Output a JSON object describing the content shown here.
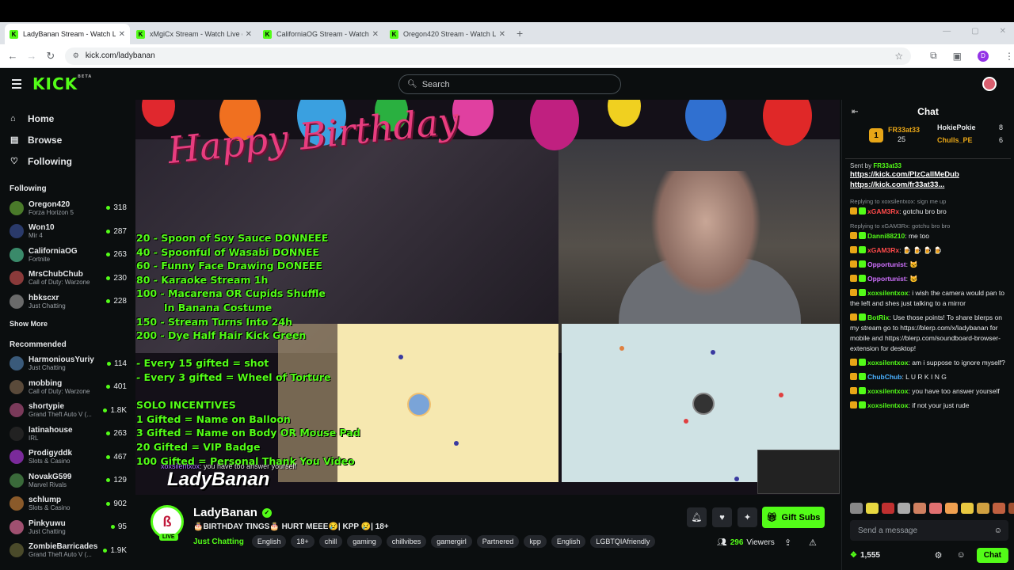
{
  "browser": {
    "tabs": [
      {
        "label": "LadyBanan Stream - Watch Live",
        "active": true
      },
      {
        "label": "xMgiCx Stream - Watch Live on",
        "active": false
      },
      {
        "label": "CaliforniaOG Stream - Watch Li",
        "active": false
      },
      {
        "label": "Oregon420 Stream - Watch Live",
        "active": false
      }
    ],
    "url": "kick.com/ladybanan",
    "profile_initial": "D"
  },
  "header": {
    "logo": "KICK",
    "logo_sup": "BETA",
    "search_placeholder": "Search"
  },
  "sidebar": {
    "nav": [
      {
        "label": "Home",
        "icon": "home-icon"
      },
      {
        "label": "Browse",
        "icon": "browse-icon"
      },
      {
        "label": "Following",
        "icon": "heart-icon"
      }
    ],
    "following_title": "Following",
    "following": [
      {
        "name": "Oregon420",
        "category": "Forza Horizon 5",
        "viewers": "318",
        "color": "#4a7a2a"
      },
      {
        "name": "Won10",
        "category": "Mir 4",
        "viewers": "287",
        "color": "#2a3a6a"
      },
      {
        "name": "CaliforniaOG",
        "category": "Fortnite",
        "viewers": "263",
        "color": "#3a8a6a"
      },
      {
        "name": "MrsChubChub",
        "category": "Call of Duty: Warzone",
        "viewers": "230",
        "color": "#8a3a3a"
      },
      {
        "name": "hbkscxr",
        "category": "Just Chatting",
        "viewers": "228",
        "color": "#6a6a6a"
      }
    ],
    "show_more": "Show More",
    "recommended_title": "Recommended",
    "recommended": [
      {
        "name": "HarmoniousYuriy",
        "category": "Just Chatting",
        "viewers": "114",
        "color": "#3a5a7a"
      },
      {
        "name": "mobbing",
        "category": "Call of Duty: Warzone",
        "viewers": "401",
        "color": "#5a4a3a"
      },
      {
        "name": "shortypie",
        "category": "Grand Theft Auto V (...",
        "viewers": "1.8K",
        "color": "#7a3a5a"
      },
      {
        "name": "latinahouse",
        "category": "IRL",
        "viewers": "263",
        "color": "#222222"
      },
      {
        "name": "Prodigyddk",
        "category": "Slots & Casino",
        "viewers": "467",
        "color": "#7a2a9a"
      },
      {
        "name": "NovakG599",
        "category": "Marvel Rivals",
        "viewers": "129",
        "color": "#3a6a3a"
      },
      {
        "name": "schlump",
        "category": "Slots & Casino",
        "viewers": "902",
        "color": "#8a5a2a"
      },
      {
        "name": "Pinkyuwu",
        "category": "Just Chatting",
        "viewers": "95",
        "color": "#a05070"
      },
      {
        "name": "ZombieBarricades",
        "category": "Grand Theft Auto V (...",
        "viewers": "1.9K",
        "color": "#4a4a2a"
      }
    ]
  },
  "video": {
    "banner": "Happy Birthday",
    "overlay_lines": "20 - Spoon of Soy Sauce DONNEEE\n40 - Spoonful of Wasabi DONNEE\n60 - Funny Face Drawing DONEEE\n80 - Karaoke Stream 1h\n100 - Macarena OR Cupids Shuffle\n        In Banana Costume\n150 - Stream Turns Into 24h\n200 - Dye Half Hair Kick Green\n\n- Every 15 gifted = shot\n- Every 3 gifted = Wheel of Torture\n\nSOLO INCENTIVES\n1 Gifted = Name on Balloon\n3 Gifted = Name on Body OR Mouse Pad\n20 Gifted = VIP Badge\n100 Gifted = Personal Thank You Video",
    "watermark": "LadyBanan",
    "ghost_user": "xoxsilentxox",
    "ghost_msg": ": you have too answer yourself"
  },
  "stream": {
    "name": "LadyBanan",
    "live": "LIVE",
    "title": "🎂BIRTHDAY TINGS🎂 HURT MEEE😢| KPP 😢| 18+",
    "category": "Just Chatting",
    "tags": [
      "English",
      "18+",
      "chill",
      "gaming",
      "chillvibes",
      "gamergirl",
      "Partnered",
      "kpp",
      "English",
      "LGBTQIAfriendly"
    ],
    "gift_label": "Gift Subs",
    "viewers": "296",
    "viewers_label": "Viewers"
  },
  "chat": {
    "title": "Chat",
    "leaderboard": [
      {
        "rank": "1",
        "name": "FR33at33",
        "value": "25",
        "color": "#e8a617"
      },
      {
        "name": "HokiePokie",
        "value": "8",
        "color": "#e6e8ea"
      },
      {
        "name": "Chulls_PE",
        "value": "6",
        "color": "#e8a617"
      }
    ],
    "pinned_by_label": "Sent by",
    "pinned_by": "FR33at33",
    "pinned_links": [
      "https://kick.com/PlzCallMeDub",
      "https://kick.com/fr33at33..."
    ],
    "messages": [
      {
        "reply": "Replying to xoxsilentxox: sign me up",
        "user": "xGAM3Rx",
        "ucolor": "#ff4a4a",
        "text": ": gotchu bro bro"
      },
      {
        "reply": "Replying to xGAM3Rx: gotchu bro bro",
        "user": "Danni88210",
        "ucolor": "#53fc18",
        "text": ": me too"
      },
      {
        "reply": "",
        "user": "xGAM3Rx",
        "ucolor": "#ff4a4a",
        "text": ": 🍺 🍺 🍺 🍺"
      },
      {
        "reply": "",
        "user": "Opportunist",
        "ucolor": "#d070ff",
        "text": ": 🐱"
      },
      {
        "reply": "",
        "user": "Opportunist",
        "ucolor": "#d070ff",
        "text": ": 🐱"
      },
      {
        "reply": "",
        "user": "xoxsilentxox",
        "ucolor": "#53fc18",
        "text": ": i wish the camera would pan to the left and shes just talking to a mirror"
      },
      {
        "reply": "",
        "user": "BotRix",
        "ucolor": "#53fc18",
        "text": ": Use those points! To share blerps on my stream go to https://blerp.com/x/ladybanan for mobile and https://blerp.com/soundboard-browser-extension for desktop!"
      },
      {
        "reply": "",
        "user": "xoxsilentxox",
        "ucolor": "#53fc18",
        "text": ": am i suppose to ignore myself?"
      },
      {
        "reply": "",
        "user": "ChubChub",
        "ucolor": "#4ab0ff",
        "text": ": L U R K I N G"
      },
      {
        "reply": "",
        "user": "xoxsilentxox",
        "ucolor": "#53fc18",
        "text": ": you have too answer yourself"
      },
      {
        "reply": "",
        "user": "xoxsilentxox",
        "ucolor": "#53fc18",
        "text": ": if not your just rude"
      }
    ],
    "input_placeholder": "Send a message",
    "points": "1,555",
    "chat_button": "Chat"
  }
}
